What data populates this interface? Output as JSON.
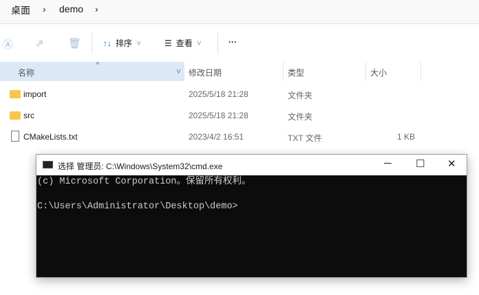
{
  "breadcrumb": [
    "桌面",
    "demo"
  ],
  "toolbar": {
    "sort": "排序",
    "view": "查看",
    "more": "···"
  },
  "columns": {
    "name": "名称",
    "date": "修改日期",
    "type": "类型",
    "size": "大小"
  },
  "files": [
    {
      "name": "import",
      "date": "2025/5/18 21:28",
      "type": "文件夹",
      "size": ""
    },
    {
      "name": "src",
      "date": "2025/5/18 21:28",
      "type": "文件夹",
      "size": ""
    },
    {
      "name": "CMakeLists.txt",
      "date": "2023/4/2 16:51",
      "type": "TXT 文件",
      "size": "1 KB"
    }
  ],
  "cmd": {
    "title": "选择 管理员: C:\\Windows\\System32\\cmd.exe",
    "lines": [
      "(c) Microsoft Corporation。保留所有权利。",
      "",
      "C:\\Users\\Administrator\\Desktop\\demo>"
    ],
    "minimize": "─",
    "maximize": "☐",
    "close": "✕"
  }
}
